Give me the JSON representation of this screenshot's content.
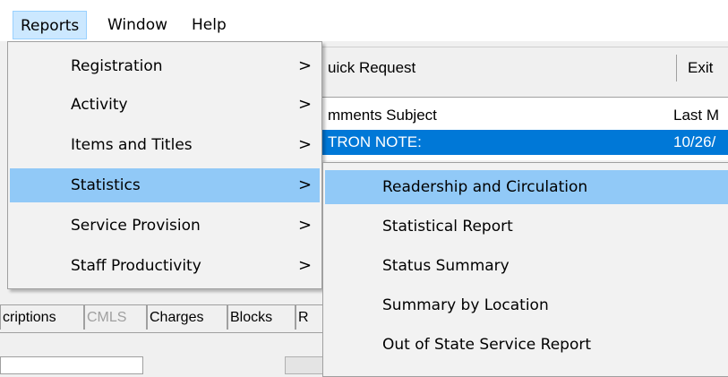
{
  "menubar": {
    "items": [
      {
        "label": "Reports",
        "active": true
      },
      {
        "label": "Window",
        "active": false
      },
      {
        "label": "Help",
        "active": false
      }
    ]
  },
  "toolbar": {
    "quick_request_label": "uick Request",
    "exit_label": "Exit"
  },
  "list": {
    "columns": [
      "mments Subject",
      "Last M"
    ],
    "selected_row": [
      "TRON NOTE:",
      "10/26/"
    ]
  },
  "tabs": [
    {
      "label": "criptions",
      "disabled": false
    },
    {
      "label": "CMLS",
      "disabled": true
    },
    {
      "label": "Charges",
      "disabled": false
    },
    {
      "label": "Blocks",
      "disabled": false
    },
    {
      "label": "R",
      "disabled": false
    }
  ],
  "reports_menu": {
    "items": [
      {
        "label": "Registration",
        "arrow": ">",
        "highlighted": false
      },
      {
        "label": "Activity",
        "arrow": ">",
        "highlighted": false
      },
      {
        "label": "Items and Titles",
        "arrow": ">",
        "highlighted": false
      },
      {
        "label": "Statistics",
        "arrow": ">",
        "highlighted": true
      },
      {
        "label": "Service Provision",
        "arrow": ">",
        "highlighted": false
      },
      {
        "label": "Staff Productivity",
        "arrow": ">",
        "highlighted": false
      }
    ]
  },
  "statistics_submenu": {
    "items": [
      {
        "label": "Readership and Circulation",
        "highlighted": true
      },
      {
        "label": "Statistical Report",
        "highlighted": false
      },
      {
        "label": "Status Summary",
        "highlighted": false
      },
      {
        "label": "Summary by Location",
        "highlighted": false
      },
      {
        "label": "Out of State Service Report",
        "highlighted": false
      }
    ]
  },
  "colors": {
    "menu_highlight": "#91c9f7",
    "selection_blue": "#0078d7",
    "menubar_active": "#cce8ff"
  }
}
